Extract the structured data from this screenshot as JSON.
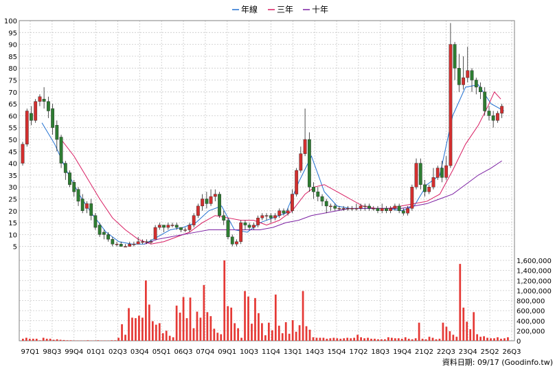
{
  "chart_data": {
    "type": "candlestick-with-volume",
    "legend": [
      {
        "name": "年線",
        "color": "#1f6fd1"
      },
      {
        "name": "三年",
        "color": "#d81b60"
      },
      {
        "name": "十年",
        "color": "#7b1fa2"
      }
    ],
    "price_axis": {
      "min": 0,
      "max": 100,
      "ticks": [
        5,
        10,
        15,
        20,
        25,
        30,
        35,
        40,
        45,
        50,
        55,
        60,
        65,
        70,
        75,
        80,
        85,
        90,
        95,
        100
      ]
    },
    "volume_axis": {
      "min": 0,
      "max": 1600000,
      "ticks": [
        0,
        200000,
        400000,
        600000,
        800000,
        1000000,
        1200000,
        1400000,
        1600000
      ],
      "tick_labels": [
        "0",
        "200,000",
        "400,000",
        "600,000",
        "800,000",
        "1,000,000",
        "1,200,000",
        "1,400,000",
        "1,600,000"
      ]
    },
    "x_labels": [
      "97Q1",
      "98Q3",
      "99Q4",
      "01Q1",
      "02Q3",
      "03Q4",
      "05Q1",
      "06Q3",
      "07Q4",
      "09Q1",
      "10Q3",
      "11Q4",
      "13Q1",
      "14Q3",
      "15Q4",
      "17Q2",
      "18Q3",
      "19Q4",
      "21Q2",
      "22Q3",
      "23Q4",
      "25Q2",
      "26Q3"
    ],
    "candles": [
      [
        0,
        40,
        48,
        39,
        49
      ],
      [
        0.67,
        48,
        62,
        47,
        63
      ],
      [
        1.33,
        61,
        58,
        56,
        64
      ],
      [
        2,
        58,
        66,
        57,
        67
      ],
      [
        2.67,
        66,
        68,
        64,
        69
      ],
      [
        3.33,
        67,
        66,
        63,
        72
      ],
      [
        4,
        66,
        62,
        59,
        68
      ],
      [
        4.67,
        63,
        55,
        52,
        65
      ],
      [
        5.33,
        56,
        50,
        45,
        58
      ],
      [
        6,
        51,
        40,
        38,
        52
      ],
      [
        6.67,
        40,
        36,
        33,
        41
      ],
      [
        7.33,
        36,
        31,
        30,
        37
      ],
      [
        8,
        32,
        28,
        26,
        33
      ],
      [
        8.67,
        29,
        24,
        22,
        30
      ],
      [
        9.33,
        25,
        20,
        19,
        27
      ],
      [
        10,
        21,
        23,
        19,
        24
      ],
      [
        10.67,
        23,
        18,
        16,
        25
      ],
      [
        11.33,
        18,
        13,
        12,
        19
      ],
      [
        12,
        14,
        10,
        9,
        15
      ],
      [
        12.67,
        11,
        10,
        8,
        12
      ],
      [
        13.33,
        10,
        8,
        7,
        11
      ],
      [
        14,
        8,
        6,
        5,
        9
      ],
      [
        14.67,
        6,
        6,
        5,
        7
      ],
      [
        15.33,
        6,
        5,
        5,
        7
      ],
      [
        16,
        5,
        5,
        5,
        6
      ],
      [
        16.67,
        5,
        6,
        5,
        7
      ],
      [
        17.33,
        6,
        6,
        5,
        7
      ],
      [
        18,
        6,
        7,
        6,
        9
      ],
      [
        18.67,
        7,
        7,
        6,
        8
      ],
      [
        19.33,
        7,
        7,
        6,
        8
      ],
      [
        20,
        7,
        7,
        6,
        8
      ],
      [
        20.67,
        8,
        13,
        8,
        14
      ],
      [
        21.33,
        13,
        14,
        12,
        15
      ],
      [
        22,
        14,
        13,
        11,
        14
      ],
      [
        22.67,
        13,
        14,
        12,
        15
      ],
      [
        23.33,
        14,
        14,
        13,
        15
      ],
      [
        24,
        14,
        13,
        12,
        15
      ],
      [
        24.67,
        13,
        12,
        11,
        13
      ],
      [
        25.33,
        12,
        12,
        11,
        13
      ],
      [
        26,
        12,
        14,
        11,
        15
      ],
      [
        26.67,
        14,
        18,
        13,
        19
      ],
      [
        27.33,
        18,
        22,
        17,
        23
      ],
      [
        28,
        22,
        25,
        20,
        27
      ],
      [
        28.67,
        25,
        23,
        21,
        28
      ],
      [
        29.33,
        23,
        26,
        22,
        29
      ],
      [
        30,
        26,
        27,
        24,
        29
      ],
      [
        30.67,
        27,
        18,
        17,
        28
      ],
      [
        31.33,
        18,
        16,
        14,
        20
      ],
      [
        32,
        16,
        9,
        8,
        17
      ],
      [
        32.67,
        9,
        6,
        5,
        10
      ],
      [
        33.33,
        6,
        7,
        5,
        8
      ],
      [
        34,
        7,
        15,
        6,
        16
      ],
      [
        34.67,
        15,
        14,
        12,
        16
      ],
      [
        35.33,
        14,
        13,
        12,
        15
      ],
      [
        36,
        13,
        14,
        12,
        15
      ],
      [
        36.67,
        14,
        17,
        13,
        18
      ],
      [
        37.33,
        17,
        18,
        16,
        19
      ],
      [
        38,
        18,
        18,
        16,
        19
      ],
      [
        38.67,
        18,
        17,
        15,
        19
      ],
      [
        39.33,
        17,
        18,
        16,
        19
      ],
      [
        40,
        18,
        20,
        17,
        21
      ],
      [
        40.67,
        20,
        19,
        18,
        21
      ],
      [
        41.33,
        19,
        20,
        18,
        21
      ],
      [
        42,
        20,
        27,
        19,
        29
      ],
      [
        42.67,
        27,
        37,
        26,
        38
      ],
      [
        43.33,
        37,
        44,
        36,
        47
      ],
      [
        44,
        44,
        50,
        43,
        63
      ],
      [
        44.67,
        50,
        30,
        28,
        53
      ],
      [
        45.33,
        30,
        28,
        25,
        32
      ],
      [
        46,
        28,
        26,
        24,
        30
      ],
      [
        46.67,
        26,
        24,
        22,
        27
      ],
      [
        47.33,
        24,
        22,
        19,
        25
      ],
      [
        48,
        22,
        22,
        20,
        23
      ],
      [
        48.67,
        22,
        21,
        20,
        23
      ],
      [
        49.33,
        21,
        21,
        20,
        22
      ],
      [
        50,
        21,
        21,
        20,
        22
      ],
      [
        50.67,
        21,
        21,
        20,
        22
      ],
      [
        51.33,
        21,
        21,
        20,
        22
      ],
      [
        52,
        21,
        21,
        20,
        23
      ],
      [
        52.67,
        21,
        22,
        20,
        23
      ],
      [
        53.33,
        22,
        22,
        20,
        23
      ],
      [
        54,
        22,
        21,
        20,
        23
      ],
      [
        54.67,
        21,
        21,
        20,
        22
      ],
      [
        55.33,
        21,
        20,
        19,
        22
      ],
      [
        56,
        20,
        21,
        19,
        23
      ],
      [
        56.67,
        21,
        20,
        19,
        22
      ],
      [
        57.33,
        20,
        21,
        19,
        22
      ],
      [
        58,
        21,
        22,
        20,
        23
      ],
      [
        58.67,
        22,
        20,
        19,
        23
      ],
      [
        59.33,
        20,
        19,
        18,
        21
      ],
      [
        60,
        19,
        21,
        18,
        22
      ],
      [
        60.67,
        21,
        30,
        20,
        31
      ],
      [
        61.33,
        30,
        40,
        29,
        42
      ],
      [
        62,
        40,
        31,
        29,
        42
      ],
      [
        62.67,
        31,
        28,
        26,
        33
      ],
      [
        63.33,
        28,
        30,
        27,
        31
      ],
      [
        64,
        30,
        34,
        29,
        38
      ],
      [
        64.67,
        34,
        38,
        33,
        39
      ],
      [
        65.33,
        38,
        34,
        32,
        41
      ],
      [
        66,
        34,
        39,
        33,
        43
      ],
      [
        66.67,
        39,
        90,
        38,
        99
      ],
      [
        67.33,
        90,
        80,
        75,
        91
      ],
      [
        68,
        80,
        73,
        70,
        86
      ],
      [
        68.67,
        73,
        76,
        71,
        85
      ],
      [
        69.33,
        76,
        79,
        74,
        89
      ],
      [
        70,
        79,
        75,
        70,
        80
      ],
      [
        70.67,
        75,
        72,
        69,
        76
      ],
      [
        71.33,
        72,
        70,
        67,
        74
      ],
      [
        72,
        70,
        62,
        60,
        72
      ],
      [
        72.67,
        62,
        60,
        58,
        64
      ],
      [
        73.33,
        60,
        58,
        55,
        62
      ],
      [
        74,
        58,
        61,
        57,
        62
      ],
      [
        74.67,
        61,
        64,
        59,
        65
      ]
    ],
    "series": [
      {
        "name": "年線",
        "color": "#1f6fd1",
        "values": [
          [
            3,
            57
          ],
          [
            5,
            48
          ],
          [
            7,
            36
          ],
          [
            9,
            26
          ],
          [
            11,
            18
          ],
          [
            13,
            11
          ],
          [
            15,
            7
          ],
          [
            17,
            6
          ],
          [
            19,
            6
          ],
          [
            21,
            9
          ],
          [
            23,
            12
          ],
          [
            25,
            13
          ],
          [
            27,
            15
          ],
          [
            29,
            20
          ],
          [
            31,
            22
          ],
          [
            33,
            12
          ],
          [
            35,
            11
          ],
          [
            37,
            15
          ],
          [
            39,
            17
          ],
          [
            41,
            19
          ],
          [
            43,
            32
          ],
          [
            45,
            43
          ],
          [
            47,
            28
          ],
          [
            49,
            22
          ],
          [
            51,
            21
          ],
          [
            53,
            21
          ],
          [
            55,
            21
          ],
          [
            57,
            21
          ],
          [
            59,
            20
          ],
          [
            61,
            22
          ],
          [
            63,
            31
          ],
          [
            65,
            35
          ],
          [
            67,
            60
          ],
          [
            69,
            72
          ],
          [
            71,
            73
          ],
          [
            73,
            65
          ],
          [
            75,
            62
          ]
        ]
      },
      {
        "name": "三年",
        "color": "#d81b60",
        "values": [
          [
            6,
            50
          ],
          [
            8,
            43
          ],
          [
            10,
            34
          ],
          [
            12,
            25
          ],
          [
            14,
            17
          ],
          [
            16,
            12
          ],
          [
            18,
            8
          ],
          [
            20,
            6
          ],
          [
            22,
            7
          ],
          [
            24,
            9
          ],
          [
            26,
            11
          ],
          [
            28,
            15
          ],
          [
            30,
            18
          ],
          [
            32,
            17
          ],
          [
            34,
            16
          ],
          [
            36,
            16
          ],
          [
            38,
            14
          ],
          [
            40,
            16
          ],
          [
            42,
            20
          ],
          [
            44,
            27
          ],
          [
            45.5,
            30
          ],
          [
            47,
            31
          ],
          [
            49,
            28
          ],
          [
            51,
            25
          ],
          [
            53,
            22
          ],
          [
            55,
            21
          ],
          [
            57,
            21
          ],
          [
            59,
            22
          ],
          [
            61,
            23
          ],
          [
            63,
            24
          ],
          [
            65,
            27
          ],
          [
            67,
            37
          ],
          [
            69,
            48
          ],
          [
            71,
            56
          ],
          [
            72.5,
            64
          ],
          [
            73.5,
            70
          ],
          [
            74.5,
            67
          ]
        ]
      },
      {
        "name": "十年",
        "color": "#7b1fa2",
        "values": [
          [
            19,
            6
          ],
          [
            21,
            8
          ],
          [
            23,
            9
          ],
          [
            25,
            10
          ],
          [
            27,
            11
          ],
          [
            29,
            12
          ],
          [
            31,
            12
          ],
          [
            33,
            12
          ],
          [
            35,
            12
          ],
          [
            37,
            12
          ],
          [
            39,
            13
          ],
          [
            41,
            15
          ],
          [
            43,
            16
          ],
          [
            45,
            18
          ],
          [
            47,
            19
          ],
          [
            49,
            20
          ],
          [
            51,
            21
          ],
          [
            53,
            21
          ],
          [
            55,
            21
          ],
          [
            57,
            21
          ],
          [
            59,
            21
          ],
          [
            61,
            22
          ],
          [
            63,
            23
          ],
          [
            65,
            25
          ],
          [
            67,
            27
          ],
          [
            69,
            31
          ],
          [
            71,
            35
          ],
          [
            73,
            38
          ],
          [
            74.67,
            41
          ]
        ]
      }
    ],
    "volume": [
      40000,
      60000,
      40000,
      40000,
      40000,
      10000,
      60000,
      40000,
      40000,
      20000,
      30000,
      20000,
      15000,
      10000,
      10000,
      5000,
      5000,
      5000,
      5000,
      10000,
      5000,
      5000,
      10000,
      5000,
      5000,
      5000,
      10000,
      10000,
      60000,
      330000,
      120000,
      650000,
      460000,
      450000,
      500000,
      460000,
      1200000,
      720000,
      390000,
      320000,
      350000,
      150000,
      200000,
      100000,
      70000,
      700000,
      560000,
      870000,
      450000,
      860000,
      250000,
      580000,
      460000,
      1110000,
      570000,
      490000,
      240000,
      160000,
      130000,
      1600000,
      690000,
      660000,
      350000,
      250000,
      60000,
      990000,
      880000,
      340000,
      850000,
      550000,
      350000,
      110000,
      360000,
      210000,
      920000,
      300000,
      150000,
      370000,
      140000,
      410000,
      180000,
      310000,
      990000,
      290000,
      220000,
      70000,
      60000,
      60000,
      60000,
      40000,
      50000,
      60000,
      50000,
      40000,
      50000,
      60000,
      50000,
      60000,
      120000,
      70000,
      50000,
      60000,
      40000,
      40000,
      30000,
      30000,
      30000,
      70000,
      60000,
      50000,
      50000,
      40000,
      70000,
      40000,
      30000,
      50000,
      360000,
      40000,
      30000,
      80000,
      60000,
      30000,
      40000,
      360000,
      280000,
      190000,
      120000,
      80000,
      1530000,
      660000,
      380000,
      230000,
      570000,
      130000,
      80000,
      90000,
      60000,
      50000,
      50000,
      70000,
      40000,
      50000,
      70000
    ],
    "source_note": "資料日期: 09/17  (Goodinfo.tw)"
  },
  "colors": {
    "up": "#d32f2f",
    "down": "#2e7d32",
    "volume": "#e53935",
    "grid": "#c8c8c8"
  }
}
